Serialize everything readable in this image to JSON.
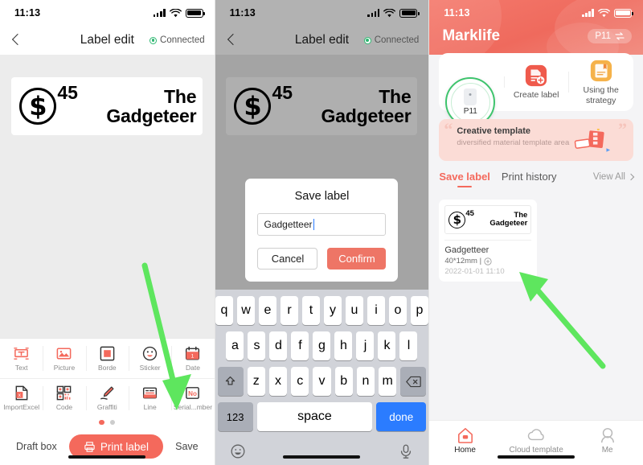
{
  "colors": {
    "accent": "#f4695c",
    "confirm": "#ee7566",
    "connected": "#2eb872",
    "keyboard_done": "#2b7cff",
    "arrow": "#5ee65e"
  },
  "status_bar": {
    "time": "11:13",
    "signal_icon": "signal-bars-icon",
    "wifi_icon": "wifi-icon",
    "battery_icon": "battery-icon"
  },
  "panel1": {
    "nav": {
      "back_icon": "back-chevron-icon",
      "title": "Label edit",
      "connection_status": "Connected"
    },
    "label": {
      "currency_symbol": "$",
      "price": "45",
      "line1": "The",
      "line2": "Gadgeteer"
    },
    "tools_row1": [
      {
        "label": "Text",
        "icon": "text-tool-icon"
      },
      {
        "label": "Picture",
        "icon": "picture-tool-icon"
      },
      {
        "label": "Borde",
        "icon": "border-tool-icon"
      },
      {
        "label": "Sticker",
        "icon": "sticker-tool-icon"
      },
      {
        "label": "Date",
        "icon": "date-tool-icon"
      }
    ],
    "tools_row2": [
      {
        "label": "ImportExcel",
        "icon": "import-excel-icon"
      },
      {
        "label": "Code",
        "icon": "qrcode-tool-icon"
      },
      {
        "label": "Graffiti",
        "icon": "graffiti-tool-icon"
      },
      {
        "label": "Line",
        "icon": "line-tool-icon"
      },
      {
        "label": "Serial...mber",
        "icon": "serial-number-icon"
      }
    ],
    "actions": {
      "draft": "Draft box",
      "print": "Print label",
      "print_icon": "printer-icon",
      "save": "Save"
    }
  },
  "panel2": {
    "nav": {
      "back_icon": "back-chevron-icon",
      "title": "Label edit",
      "connection_status": "Connected"
    },
    "label": {
      "currency_symbol": "$",
      "price": "45",
      "line1": "The",
      "line2": "Gadgeteer"
    },
    "dialog": {
      "title": "Save label",
      "input_value": "Gadgetteer",
      "cancel": "Cancel",
      "confirm": "Confirm"
    },
    "keyboard": {
      "row1": [
        "q",
        "w",
        "e",
        "r",
        "t",
        "y",
        "u",
        "i",
        "o",
        "p"
      ],
      "row2": [
        "a",
        "s",
        "d",
        "f",
        "g",
        "h",
        "j",
        "k",
        "l"
      ],
      "row3": [
        "z",
        "x",
        "c",
        "v",
        "b",
        "n",
        "m"
      ],
      "shift_icon": "shift-key-icon",
      "backspace_icon": "backspace-key-icon",
      "numbers_key": "123",
      "space_key": "space",
      "done_key": "done",
      "emoji_icon": "emoji-key-icon",
      "mic_icon": "microphone-key-icon"
    }
  },
  "panel3": {
    "header": {
      "app_title": "Marklife",
      "device_badge": "P11",
      "swap_icon": "swap-arrows-icon"
    },
    "top_card": [
      {
        "label": "P11",
        "icon": "printer-device-icon",
        "type": "device"
      },
      {
        "label": "Create label",
        "icon": "create-label-icon",
        "type": "action"
      },
      {
        "label": "Using the strategy",
        "icon": "guide-book-icon",
        "type": "action"
      }
    ],
    "banner": {
      "title": "Creative template",
      "subtitle": "diversified material template area",
      "icon": "template-stack-icon"
    },
    "tabs": [
      {
        "label": "Save label",
        "active": true
      },
      {
        "label": "Print history",
        "active": false
      }
    ],
    "view_all": "View All",
    "view_all_icon": "chevron-right-icon",
    "saved_card": {
      "preview": {
        "currency_symbol": "$",
        "price": "45",
        "line1": "The",
        "line2": "Gadgeteer"
      },
      "name": "Gadgetteer",
      "meta": "40*12mm |",
      "meta_icon": "label-size-icon",
      "date": "2022-01-01 11:10"
    },
    "tabbar": [
      {
        "label": "Home",
        "icon": "home-icon",
        "active": true
      },
      {
        "label": "Cloud template",
        "icon": "cloud-icon",
        "active": false
      },
      {
        "label": "Me",
        "icon": "person-icon",
        "active": false
      }
    ]
  }
}
